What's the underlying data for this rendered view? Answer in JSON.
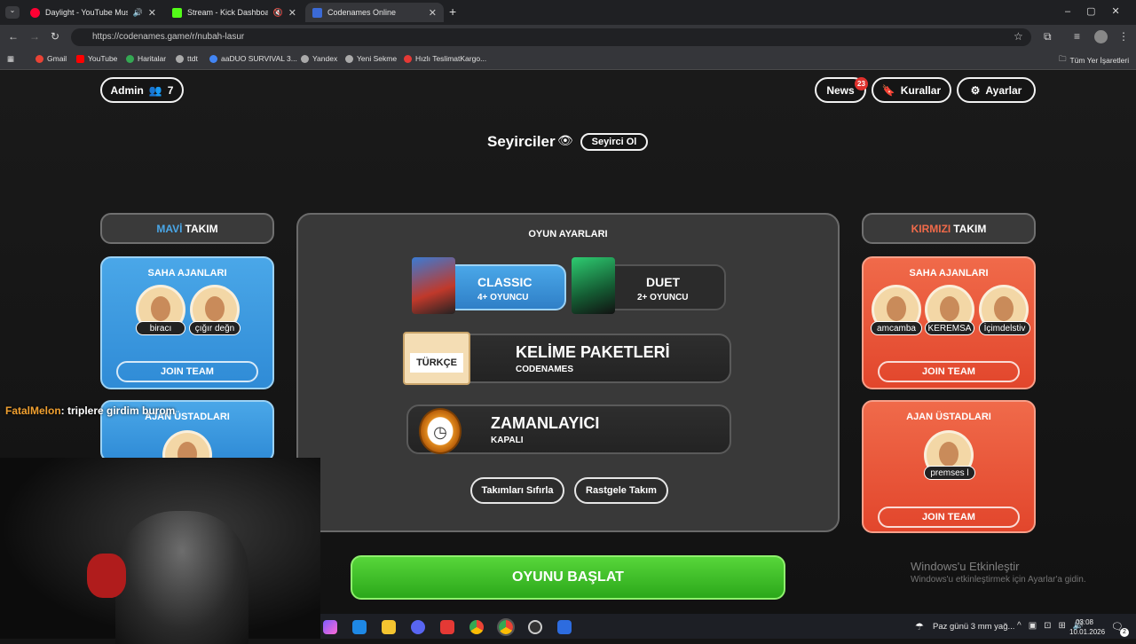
{
  "browser": {
    "tabs": [
      {
        "label": "Daylight - YouTube Music",
        "color": "#ff0033"
      },
      {
        "label": "Stream - Kick Dashboard",
        "color": "#53fc18"
      },
      {
        "label": "Codenames Online",
        "color": "#3b6ad6"
      }
    ],
    "url": "https://codenames.game/r/nubah-lasur",
    "bookmarks": [
      "Gmail",
      "YouTube",
      "Haritalar",
      "ttdt",
      "aaDUO SURVIVAL 3...",
      "Yandex",
      "Yeni Sekme",
      "Hızlı TeslimatKargo..."
    ],
    "bookmarks_right": "Tüm Yer İşaretleri"
  },
  "header": {
    "admin_label": "Admin",
    "player_count": "7",
    "news_label": "News",
    "news_badge": "23",
    "rules_label": "Kurallar",
    "settings_label": "Ayarlar"
  },
  "spectators": {
    "title": "Seyirciler",
    "button": "Seyirci Ol"
  },
  "blue_team": {
    "title_colored": "MAVİ",
    "title_rest": "TAKIM",
    "field_agents_title": "SAHA AJANLARI",
    "players": [
      "biracı",
      "çığır değn"
    ],
    "join_label": "JOIN TEAM",
    "spymasters_title": "AJAN ÜSTADLARI",
    "color": "#4aa7e8"
  },
  "red_team": {
    "title_colored": "KIRMIZI",
    "title_rest": "TAKIM",
    "field_agents_title": "SAHA AJANLARI",
    "players": [
      "amcamba",
      "KEREMSA",
      "İçimdelstiv"
    ],
    "join_label": "JOIN TEAM",
    "spymasters_title": "AJAN ÜSTADLARI",
    "spymasters": [
      "premses l"
    ],
    "join2_label": "JOIN TEAM",
    "color": "#f06a4a"
  },
  "game_settings": {
    "title": "OYUN AYARLARI",
    "classic": {
      "label": "CLASSIC",
      "sub": "4+ OYUNCU",
      "selected": true
    },
    "duet": {
      "label": "DUET",
      "sub": "2+ OYUNCU",
      "selected": false
    },
    "word_pack": {
      "label": "KELİME PAKETLERİ",
      "sub": "CODENAMES",
      "tag": "TÜRKÇE"
    },
    "timer": {
      "label": "ZAMANLAYICI",
      "sub": "KAPALI"
    },
    "reset_button": "Takımları Sıfırla",
    "random_button": "Rastgele Takım"
  },
  "start_button": "OYUNU BAŞLAT",
  "chat_overlay": {
    "user": "FatalMelon",
    "message": ": triplere girdim burom"
  },
  "windows": {
    "activate_title": "Windows'u Etkinleştir",
    "activate_sub": "Windows'u etkinleştirmek için Ayarlar'a gidin.",
    "weather": "Paz günü 3 mm yağ...",
    "time": "03:08",
    "date": "10.01.2026",
    "notification_count": "2"
  }
}
